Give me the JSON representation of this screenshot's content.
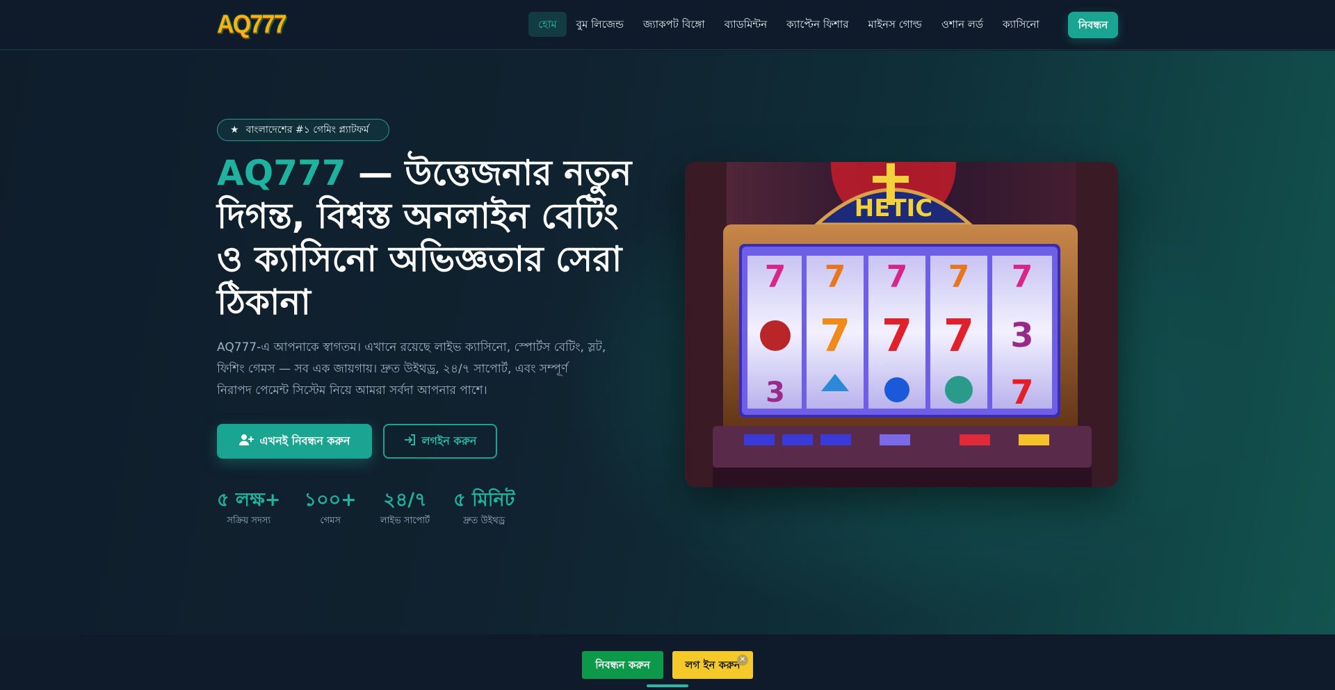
{
  "header": {
    "logo_text": "AQ777",
    "nav": [
      {
        "label": "হোম",
        "active": true
      },
      {
        "label": "বুম লিজেন্ড",
        "active": false
      },
      {
        "label": "জ্যাকপট বিঙ্গো",
        "active": false
      },
      {
        "label": "ব্যাডমিন্টন",
        "active": false
      },
      {
        "label": "ক্যাপ্টেন ফিশার",
        "active": false
      },
      {
        "label": "মাইনস গোল্ড",
        "active": false
      },
      {
        "label": "ওশান লর্ড",
        "active": false
      },
      {
        "label": "ক্যাসিনো",
        "active": false
      }
    ],
    "register_label": "নিবন্ধন"
  },
  "hero": {
    "badge": "বাংলাদেশের #১ গেমিং প্ল্যাটফর্ম",
    "badge_icon": "star-icon",
    "headline_brand": "AQ777",
    "headline_rest": " — উত্তেজনার নতুন দিগন্ত, বিশ্বস্ত অনলাইন বেটিং ও ক্যাসিনো অভিজ্ঞতার সেরা ঠিকানা",
    "description": "AQ777-এ আপনাকে স্বাগতম। এখানে রয়েছে লাইভ ক্যাসিনো, স্পোর্টস বেটিং, স্লট, ফিশিং গেমস — সব এক জায়গায়। দ্রুত উইথড্র, ২৪/৭ সাপোর্ট, এবং সম্পূর্ণ নিরাপদ পেমেন্ট সিস্টেম নিয়ে আমরা সর্বদা আপনার পাশে।",
    "primary_button": "এখনই নিবন্ধন করুন",
    "primary_icon": "user-plus-icon",
    "secondary_button": "লগইন করুন",
    "secondary_icon": "login-icon",
    "stats": [
      {
        "value": "৫ লক্ষ+",
        "label": "সক্রিয় সদস্য"
      },
      {
        "value": "১০০+",
        "label": "গেমস"
      },
      {
        "value": "২৪/৭",
        "label": "লাইভ সাপোর্ট"
      },
      {
        "value": "৫ মিনিট",
        "label": "দ্রুত উইথড্র"
      }
    ],
    "image_sign_text": "HETIC"
  },
  "bottom_bar": {
    "register": "নিবন্ধন করুন",
    "login": "লগ ইন করুন",
    "close_icon": "close-icon"
  },
  "colors": {
    "accent": "#1aa593",
    "background": "#0f1a2a",
    "bottom_register": "#0c9a4a",
    "bottom_login": "#f5c92a"
  }
}
